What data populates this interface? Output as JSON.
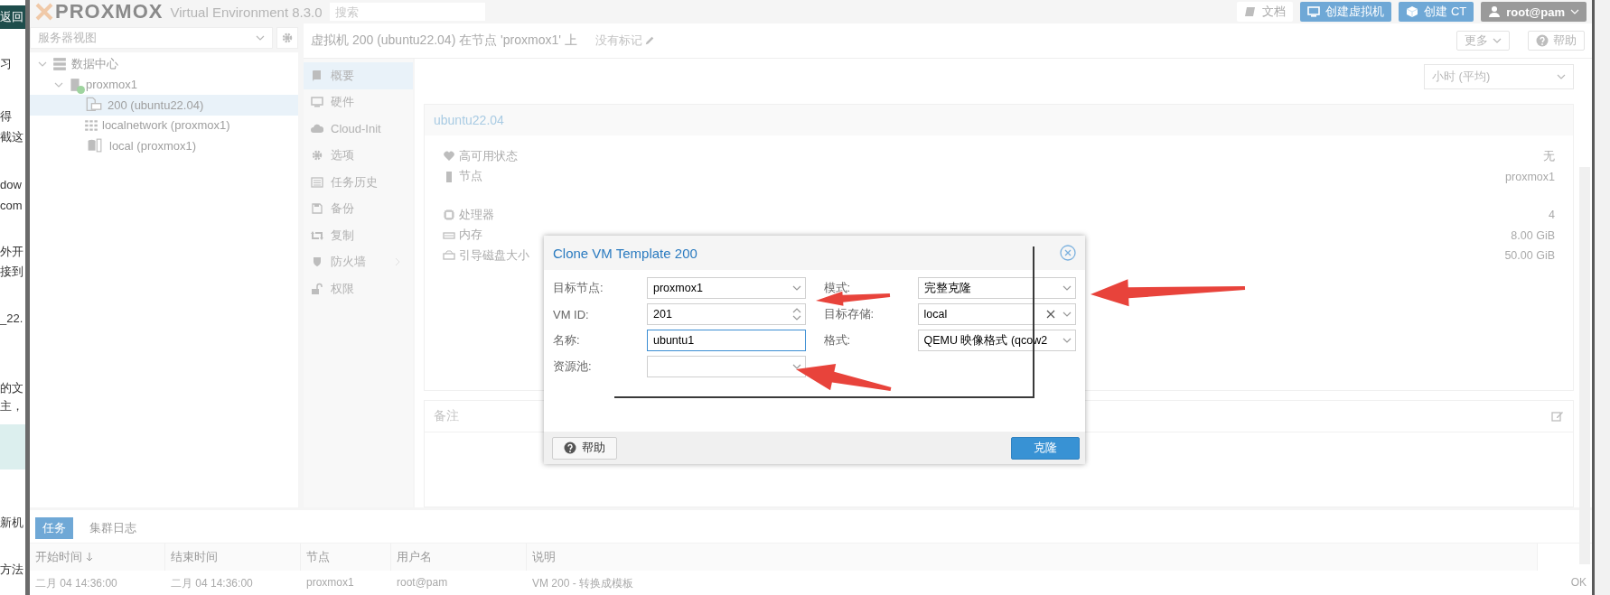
{
  "side_page": {
    "texts": [
      "返回",
      "习",
      "得",
      "截这",
      "dow",
      "com",
      "外开",
      "接到",
      "_22.",
      "的文",
      "主，",
      "新机",
      "方法"
    ]
  },
  "header": {
    "logo": "PROXMOX",
    "version": "Virtual Environment 8.3.0",
    "search": {
      "placeholder": "搜索"
    },
    "buttons": [
      {
        "kind": "docs",
        "label": "文档"
      },
      {
        "kind": "create-vm",
        "label": "创建虚拟机"
      },
      {
        "kind": "create-ct",
        "label": "创建 CT"
      },
      {
        "kind": "user",
        "label": "root@pam"
      }
    ]
  },
  "sidebar": {
    "view": "服务器视图",
    "tree": [
      {
        "label": "数据中心",
        "kind": "datacenter",
        "expanded": true,
        "selected": false,
        "children": [
          {
            "label": "proxmox1",
            "kind": "node",
            "expanded": true,
            "selected": false,
            "online": true,
            "children": [
              {
                "label": "200 (ubuntu22.04)",
                "kind": "template",
                "selected": true
              },
              {
                "label": "localnetwork (proxmox1)",
                "kind": "network",
                "selected": false
              },
              {
                "label": "local (proxmox1)",
                "kind": "storage",
                "selected": false
              }
            ]
          }
        ]
      }
    ]
  },
  "content_header": {
    "title": "虚拟机 200 (ubuntu22.04) 在节点 'proxmox1' 上",
    "tags": "没有标记",
    "buttons": [
      {
        "kind": "more",
        "label": "更多"
      },
      {
        "kind": "help",
        "label": "帮助"
      }
    ]
  },
  "nav": [
    {
      "label": "概要",
      "selected": true,
      "submenu": false
    },
    {
      "label": "硬件",
      "selected": false,
      "submenu": false
    },
    {
      "label": "Cloud-Init",
      "selected": false,
      "submenu": false
    },
    {
      "label": "选项",
      "selected": false,
      "submenu": false
    },
    {
      "label": "任务历史",
      "selected": false,
      "submenu": false
    },
    {
      "label": "备份",
      "selected": false,
      "submenu": false
    },
    {
      "label": "复制",
      "selected": false,
      "submenu": false
    },
    {
      "label": "防火墙",
      "selected": false,
      "submenu": true
    },
    {
      "label": "权限",
      "selected": false,
      "submenu": false
    }
  ],
  "timeframe": "小时 (平均)",
  "summary": {
    "title": "ubuntu22.04",
    "groups": [
      [
        {
          "label": "高可用状态",
          "value": "无"
        },
        {
          "label": "节点",
          "value": "proxmox1"
        }
      ],
      [
        {
          "label": "处理器",
          "value": "4"
        },
        {
          "label": "内存",
          "value": "8.00 GiB"
        },
        {
          "label": "引导磁盘大小",
          "value": "50.00 GiB"
        }
      ]
    ]
  },
  "notes": {
    "title": "备注"
  },
  "tasks": {
    "tabs": [
      {
        "label": "任务",
        "selected": true
      },
      {
        "label": "集群日志",
        "selected": false
      }
    ],
    "columns": [
      {
        "label": "开始时间",
        "sorted": true
      },
      {
        "label": "结束时间",
        "sorted": false
      },
      {
        "label": "节点",
        "sorted": false
      },
      {
        "label": "用户名",
        "sorted": false
      },
      {
        "label": "说明",
        "sorted": false
      }
    ],
    "rows": [
      [
        "二月 04 14:36:00",
        "二月 04 14:36:00",
        "proxmox1",
        "root@pam",
        "VM 200 - 转换成模板",
        "OK"
      ]
    ]
  },
  "dialog": {
    "title": "Clone VM Template 200",
    "left": [
      {
        "label": "目标节点:",
        "kind": "combo",
        "value": "proxmox1",
        "focused": false
      },
      {
        "label": "VM ID:",
        "kind": "spinner",
        "value": "201",
        "focused": false
      },
      {
        "label": "名称:",
        "kind": "text",
        "value": "ubuntu1",
        "focused": true
      },
      {
        "label": "资源池:",
        "kind": "combo",
        "focused": false
      }
    ],
    "right": [
      {
        "label": "模式:",
        "kind": "combo",
        "value": "完整克隆",
        "clearable": false
      },
      {
        "label": "目标存储:",
        "kind": "combo",
        "value": "local",
        "clearable": true
      },
      {
        "label": "格式:",
        "kind": "combo",
        "value": "QEMU 映像格式 (qcow2",
        "clearable": false
      }
    ],
    "buttons": [
      {
        "kind": "help",
        "label": "帮助"
      },
      {
        "kind": "primary",
        "label": "克隆"
      }
    ]
  }
}
